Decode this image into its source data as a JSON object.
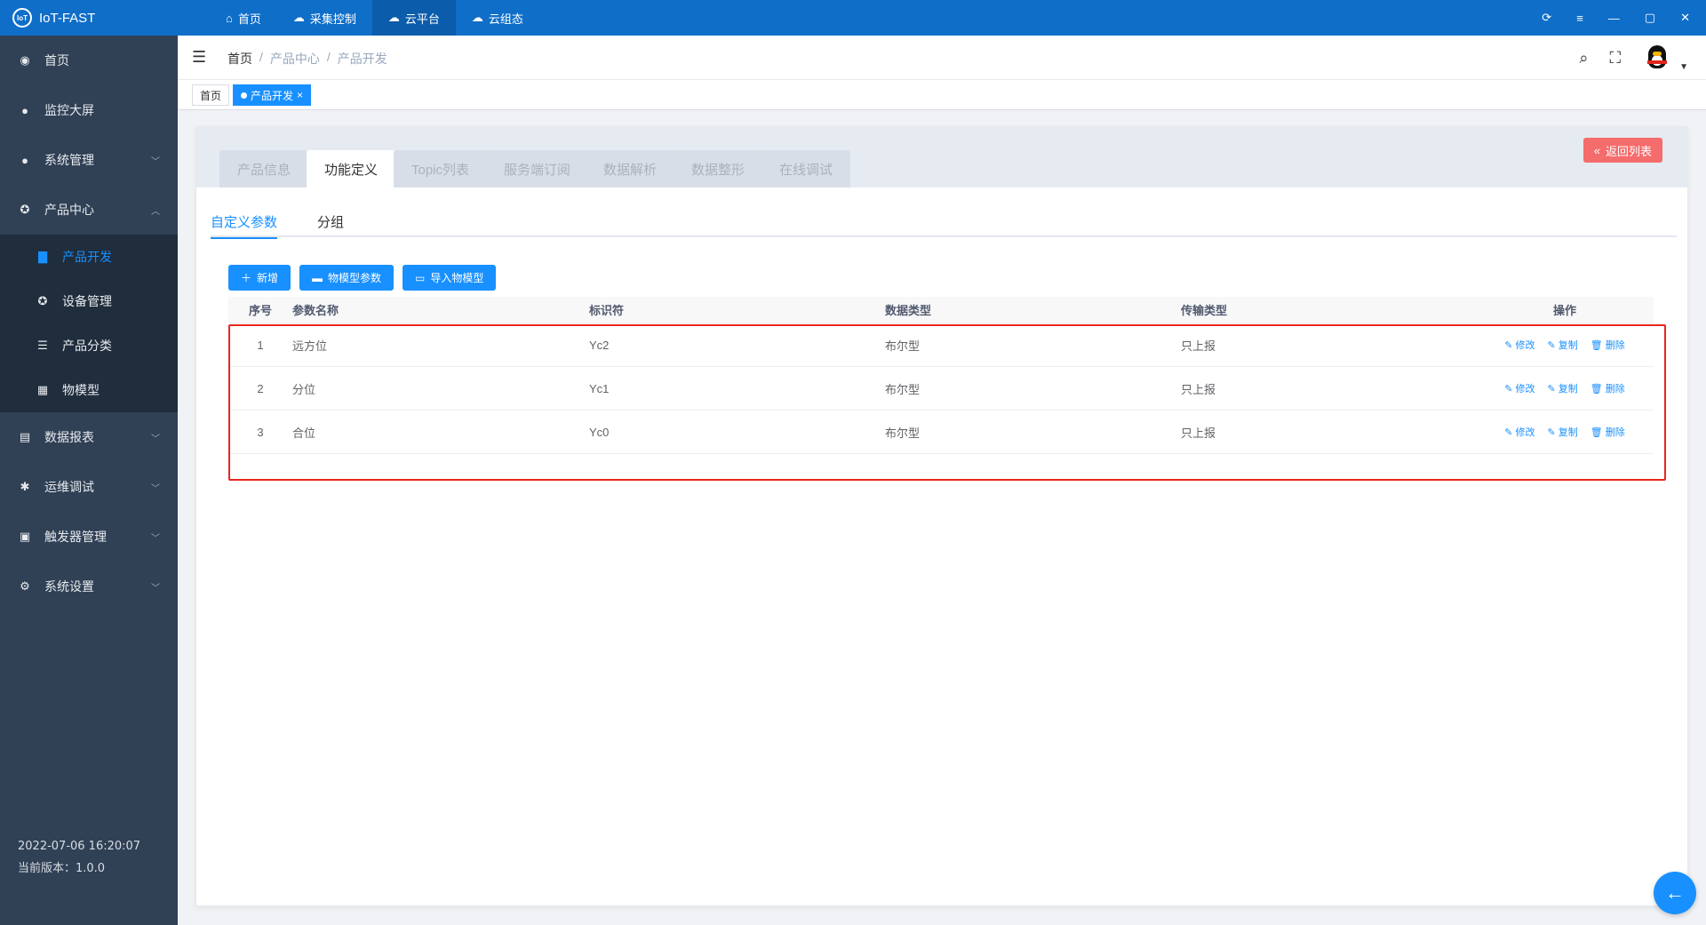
{
  "app": {
    "title": "IoT-FAST",
    "logo_text": "IoT"
  },
  "topnav": [
    {
      "label": "首页",
      "icon": "home-icon"
    },
    {
      "label": "采集控制",
      "icon": "cloud-icon"
    },
    {
      "label": "云平台",
      "icon": "cloud-platform-icon"
    },
    {
      "label": "云组态",
      "icon": "cloud-config-icon"
    }
  ],
  "sidebar": {
    "items": [
      {
        "label": "首页",
        "icon": "dashboard-icon"
      },
      {
        "label": "监控大屏",
        "icon": "globe-icon"
      },
      {
        "label": "系统管理",
        "icon": "user-icon"
      },
      {
        "label": "产品中心",
        "icon": "product-icon"
      },
      {
        "label": "数据报表",
        "icon": "report-icon"
      },
      {
        "label": "运维调试",
        "icon": "bug-icon"
      },
      {
        "label": "触发器管理",
        "icon": "trigger-icon"
      },
      {
        "label": "系统设置",
        "icon": "gear-icon"
      }
    ],
    "sub": [
      {
        "label": "产品开发",
        "icon": "folder-icon"
      },
      {
        "label": "设备管理",
        "icon": "device-icon"
      },
      {
        "label": "产品分类",
        "icon": "list-icon"
      },
      {
        "label": "物模型",
        "icon": "grid-icon"
      }
    ],
    "footer": {
      "datetime": "2022-07-06 16:20:07",
      "version": "当前版本：1.0.0"
    }
  },
  "breadcrumb": {
    "home": "首页",
    "sep": "/",
    "level1": "产品中心",
    "level2": "产品开发"
  },
  "tags": {
    "home": "首页",
    "active": "产品开发",
    "close": "×"
  },
  "product_tabs": [
    "产品信息",
    "功能定义",
    "Topic列表",
    "服务端订阅",
    "数据解析",
    "数据整形",
    "在线调试"
  ],
  "back_label": "返回列表",
  "subtabs": [
    "自定义参数",
    "分组"
  ],
  "buttons": {
    "add": "新增",
    "model_params": "物模型参数",
    "import_model": "导入物模型"
  },
  "table": {
    "headers": {
      "idx": "序号",
      "name": "参数名称",
      "identifier": "标识符",
      "data_type": "数据类型",
      "transfer_type": "传输类型",
      "ops": "操作"
    },
    "rows": [
      {
        "idx": "1",
        "name": "远方位",
        "identifier": "Yc2",
        "data_type": "布尔型",
        "transfer_type": "只上报"
      },
      {
        "idx": "2",
        "name": "分位",
        "identifier": "Yc1",
        "data_type": "布尔型",
        "transfer_type": "只上报"
      },
      {
        "idx": "3",
        "name": "合位",
        "identifier": "Yc0",
        "data_type": "布尔型",
        "transfer_type": "只上报"
      }
    ],
    "ops": {
      "edit": "修改",
      "copy": "复制",
      "delete": "删除"
    }
  },
  "colors": {
    "topbar": "#0f6ec8",
    "sidebar": "#304156",
    "accent": "#1890ff",
    "danger": "#f56c6c",
    "highlight": "#e8261f"
  }
}
